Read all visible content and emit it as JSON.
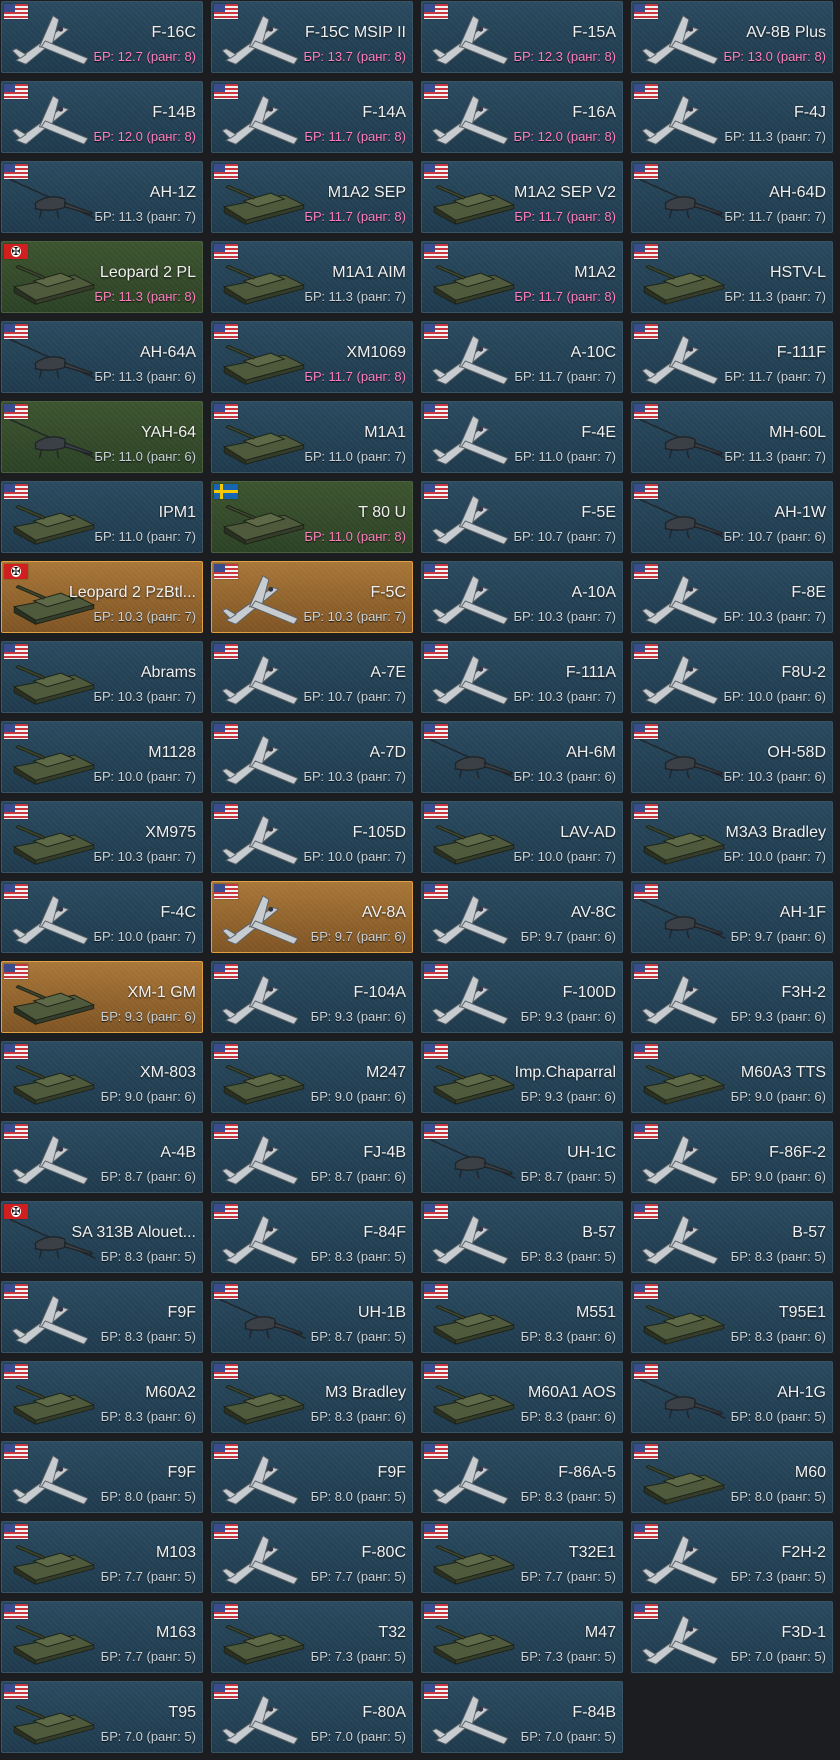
{
  "colors": {
    "background": "#1b1d20",
    "card_blue": "#234357",
    "card_green": "#34492a",
    "card_gold": "#93652e",
    "br_highlight": "#ff7fbf",
    "br_normal": "#c9d2d8"
  },
  "vehicles": [
    {
      "name": "F-16C",
      "br": "БР: 12.7 (ранг: 8)",
      "flag": "usa",
      "kind": "jet",
      "style": "blue",
      "hl": true
    },
    {
      "name": "F-15C MSIP II",
      "br": "БР: 13.7 (ранг: 8)",
      "flag": "usa",
      "kind": "jet",
      "style": "blue",
      "hl": true
    },
    {
      "name": "F-15A",
      "br": "БР: 12.3 (ранг: 8)",
      "flag": "usa",
      "kind": "jet",
      "style": "blue",
      "hl": true
    },
    {
      "name": "AV-8B Plus",
      "br": "БР: 13.0 (ранг: 8)",
      "flag": "usa",
      "kind": "jet",
      "style": "blue",
      "hl": true
    },
    {
      "name": "F-14B",
      "br": "БР: 12.0 (ранг: 8)",
      "flag": "usa",
      "kind": "jet",
      "style": "blue",
      "hl": true
    },
    {
      "name": "F-14A",
      "br": "БР: 11.7 (ранг: 8)",
      "flag": "usa",
      "kind": "jet",
      "style": "blue",
      "hl": true
    },
    {
      "name": "F-16A",
      "br": "БР: 12.0 (ранг: 8)",
      "flag": "usa",
      "kind": "jet",
      "style": "blue",
      "hl": true
    },
    {
      "name": "F-4J",
      "br": "БР: 11.3 (ранг: 7)",
      "flag": "usa",
      "kind": "jet",
      "style": "blue",
      "hl": false
    },
    {
      "name": "AH-1Z",
      "br": "БР: 11.3 (ранг: 7)",
      "flag": "usa",
      "kind": "heli",
      "style": "blue",
      "hl": false
    },
    {
      "name": "M1A2 SEP",
      "br": "БР: 11.7 (ранг: 8)",
      "flag": "usa",
      "kind": "tank",
      "style": "blue",
      "hl": true
    },
    {
      "name": "M1A2 SEP V2",
      "br": "БР: 11.7 (ранг: 8)",
      "flag": "usa",
      "kind": "tank",
      "style": "blue",
      "hl": true
    },
    {
      "name": "AH-64D",
      "br": "БР: 11.7 (ранг: 7)",
      "flag": "usa",
      "kind": "heli",
      "style": "blue",
      "hl": false
    },
    {
      "name": "Leopard 2 PL",
      "br": "БР: 11.3 (ранг: 8)",
      "flag": "germany",
      "kind": "tank",
      "style": "green",
      "hl": true
    },
    {
      "name": "M1A1 AIM",
      "br": "БР: 11.3 (ранг: 7)",
      "flag": "usa",
      "kind": "tank",
      "style": "blue",
      "hl": false
    },
    {
      "name": "M1A2",
      "br": "БР: 11.7 (ранг: 8)",
      "flag": "usa",
      "kind": "tank",
      "style": "blue",
      "hl": true
    },
    {
      "name": "HSTV-L",
      "br": "БР: 11.3 (ранг: 7)",
      "flag": "usa",
      "kind": "tank",
      "style": "blue",
      "hl": false
    },
    {
      "name": "AH-64A",
      "br": "БР: 11.3 (ранг: 6)",
      "flag": "usa",
      "kind": "heli",
      "style": "blue",
      "hl": false
    },
    {
      "name": "XM1069",
      "br": "БР: 11.7 (ранг: 8)",
      "flag": "usa",
      "kind": "tank",
      "style": "blue",
      "hl": true
    },
    {
      "name": "A-10C",
      "br": "БР: 11.7 (ранг: 7)",
      "flag": "usa",
      "kind": "jet",
      "style": "blue",
      "hl": false
    },
    {
      "name": "F-111F",
      "br": "БР: 11.7 (ранг: 7)",
      "flag": "usa",
      "kind": "jet",
      "style": "blue",
      "hl": false
    },
    {
      "name": "YAH-64",
      "br": "БР: 11.0 (ранг: 6)",
      "flag": "usa",
      "kind": "heli",
      "style": "green",
      "hl": false
    },
    {
      "name": "M1A1",
      "br": "БР: 11.0 (ранг: 7)",
      "flag": "usa",
      "kind": "tank",
      "style": "blue",
      "hl": false
    },
    {
      "name": "F-4E",
      "br": "БР: 11.0 (ранг: 7)",
      "flag": "usa",
      "kind": "jet",
      "style": "blue",
      "hl": false
    },
    {
      "name": "MH-60L",
      "br": "БР: 11.3 (ранг: 7)",
      "flag": "usa",
      "kind": "heli",
      "style": "blue",
      "hl": false
    },
    {
      "name": "IPM1",
      "br": "БР: 11.0 (ранг: 7)",
      "flag": "usa",
      "kind": "tank",
      "style": "blue",
      "hl": false
    },
    {
      "name": "T 80 U",
      "br": "БР: 11.0 (ранг: 8)",
      "flag": "sweden",
      "kind": "tank",
      "style": "green",
      "hl": true
    },
    {
      "name": "F-5E",
      "br": "БР: 10.7 (ранг: 7)",
      "flag": "usa",
      "kind": "jet",
      "style": "blue",
      "hl": false
    },
    {
      "name": "AH-1W",
      "br": "БР: 10.7 (ранг: 6)",
      "flag": "usa",
      "kind": "heli",
      "style": "blue",
      "hl": false
    },
    {
      "name": "Leopard 2 PzBtl...",
      "br": "БР: 10.3 (ранг: 7)",
      "flag": "germany",
      "kind": "tank",
      "style": "gold",
      "hl": false
    },
    {
      "name": "F-5C",
      "br": "БР: 10.3 (ранг: 7)",
      "flag": "usa",
      "kind": "jet",
      "style": "gold",
      "hl": false
    },
    {
      "name": "A-10A",
      "br": "БР: 10.3 (ранг: 7)",
      "flag": "usa",
      "kind": "jet",
      "style": "blue",
      "hl": false
    },
    {
      "name": "F-8E",
      "br": "БР: 10.3 (ранг: 7)",
      "flag": "usa",
      "kind": "jet",
      "style": "blue",
      "hl": false
    },
    {
      "name": "Abrams",
      "br": "БР: 10.3 (ранг: 7)",
      "flag": "usa",
      "kind": "tank",
      "style": "blue",
      "hl": false
    },
    {
      "name": "A-7E",
      "br": "БР: 10.7 (ранг: 7)",
      "flag": "usa",
      "kind": "jet",
      "style": "blue",
      "hl": false
    },
    {
      "name": "F-111A",
      "br": "БР: 10.3 (ранг: 7)",
      "flag": "usa",
      "kind": "jet",
      "style": "blue",
      "hl": false
    },
    {
      "name": "F8U-2",
      "br": "БР: 10.0 (ранг: 6)",
      "flag": "usa",
      "kind": "jet",
      "style": "blue",
      "hl": false
    },
    {
      "name": "M1128",
      "br": "БР: 10.0 (ранг: 7)",
      "flag": "usa",
      "kind": "tank",
      "style": "blue",
      "hl": false
    },
    {
      "name": "A-7D",
      "br": "БР: 10.3 (ранг: 7)",
      "flag": "usa",
      "kind": "jet",
      "style": "blue",
      "hl": false
    },
    {
      "name": "AH-6M",
      "br": "БР: 10.3 (ранг: 6)",
      "flag": "usa",
      "kind": "heli",
      "style": "blue",
      "hl": false
    },
    {
      "name": "OH-58D",
      "br": "БР: 10.3 (ранг: 6)",
      "flag": "usa",
      "kind": "heli",
      "style": "blue",
      "hl": false
    },
    {
      "name": "XM975",
      "br": "БР: 10.3 (ранг: 7)",
      "flag": "usa",
      "kind": "tank",
      "style": "blue",
      "hl": false
    },
    {
      "name": "F-105D",
      "br": "БР: 10.0 (ранг: 7)",
      "flag": "usa",
      "kind": "jet",
      "style": "blue",
      "hl": false
    },
    {
      "name": "LAV-AD",
      "br": "БР: 10.0 (ранг: 7)",
      "flag": "usa",
      "kind": "tank",
      "style": "blue",
      "hl": false
    },
    {
      "name": "M3A3 Bradley",
      "br": "БР: 10.0 (ранг: 7)",
      "flag": "usa",
      "kind": "tank",
      "style": "blue",
      "hl": false
    },
    {
      "name": "F-4C",
      "br": "БР: 10.0 (ранг: 7)",
      "flag": "usa",
      "kind": "jet",
      "style": "blue",
      "hl": false
    },
    {
      "name": "AV-8A",
      "br": "БР: 9.7 (ранг: 6)",
      "flag": "usa",
      "kind": "jet",
      "style": "gold",
      "hl": false
    },
    {
      "name": "AV-8C",
      "br": "БР: 9.7 (ранг: 6)",
      "flag": "usa",
      "kind": "jet",
      "style": "blue",
      "hl": false
    },
    {
      "name": "AH-1F",
      "br": "БР: 9.7 (ранг: 6)",
      "flag": "usa",
      "kind": "heli",
      "style": "blue",
      "hl": false
    },
    {
      "name": "XM-1 GM",
      "br": "БР: 9.3 (ранг: 6)",
      "flag": "usa",
      "kind": "tank",
      "style": "gold",
      "hl": false
    },
    {
      "name": "F-104A",
      "br": "БР: 9.3 (ранг: 6)",
      "flag": "usa",
      "kind": "jet",
      "style": "blue",
      "hl": false
    },
    {
      "name": "F-100D",
      "br": "БР: 9.3 (ранг: 6)",
      "flag": "usa",
      "kind": "jet",
      "style": "blue",
      "hl": false
    },
    {
      "name": "F3H-2",
      "br": "БР: 9.3 (ранг: 6)",
      "flag": "usa",
      "kind": "jet",
      "style": "blue",
      "hl": false
    },
    {
      "name": "XM-803",
      "br": "БР: 9.0 (ранг: 6)",
      "flag": "usa",
      "kind": "tank",
      "style": "blue",
      "hl": false
    },
    {
      "name": "M247",
      "br": "БР: 9.0 (ранг: 6)",
      "flag": "usa",
      "kind": "tank",
      "style": "blue",
      "hl": false
    },
    {
      "name": "Imp.Chaparral",
      "br": "БР: 9.3 (ранг: 6)",
      "flag": "usa",
      "kind": "tank",
      "style": "blue",
      "hl": false
    },
    {
      "name": "M60A3 TTS",
      "br": "БР: 9.0 (ранг: 6)",
      "flag": "usa",
      "kind": "tank",
      "style": "blue",
      "hl": false
    },
    {
      "name": "A-4B",
      "br": "БР: 8.7 (ранг: 6)",
      "flag": "usa",
      "kind": "jet",
      "style": "blue",
      "hl": false
    },
    {
      "name": "FJ-4B",
      "br": "БР: 8.7 (ранг: 6)",
      "flag": "usa",
      "kind": "jet",
      "style": "blue",
      "hl": false
    },
    {
      "name": "UH-1C",
      "br": "БР: 8.7 (ранг: 5)",
      "flag": "usa",
      "kind": "heli",
      "style": "blue",
      "hl": false
    },
    {
      "name": "F-86F-2",
      "br": "БР: 9.0 (ранг: 6)",
      "flag": "usa",
      "kind": "jet",
      "style": "blue",
      "hl": false
    },
    {
      "name": "SA 313B Alouet...",
      "br": "БР: 8.3 (ранг: 5)",
      "flag": "germany",
      "kind": "heli",
      "style": "blue",
      "hl": false
    },
    {
      "name": "F-84F",
      "br": "БР: 8.3 (ранг: 5)",
      "flag": "usa",
      "kind": "jet",
      "style": "blue",
      "hl": false
    },
    {
      "name": "B-57",
      "br": "БР: 8.3 (ранг: 5)",
      "flag": "usa",
      "kind": "jet",
      "style": "blue",
      "hl": false
    },
    {
      "name": "B-57",
      "br": "БР: 8.3 (ранг: 5)",
      "flag": "usa",
      "kind": "jet",
      "style": "blue",
      "hl": false
    },
    {
      "name": "F9F",
      "br": "БР: 8.3 (ранг: 5)",
      "flag": "usa",
      "kind": "jet",
      "style": "blue",
      "hl": false
    },
    {
      "name": "UH-1B",
      "br": "БР: 8.7 (ранг: 5)",
      "flag": "usa",
      "kind": "heli",
      "style": "blue",
      "hl": false
    },
    {
      "name": "M551",
      "br": "БР: 8.3 (ранг: 6)",
      "flag": "usa",
      "kind": "tank",
      "style": "blue",
      "hl": false
    },
    {
      "name": "T95E1",
      "br": "БР: 8.3 (ранг: 6)",
      "flag": "usa",
      "kind": "tank",
      "style": "blue",
      "hl": false
    },
    {
      "name": "M60A2",
      "br": "БР: 8.3 (ранг: 6)",
      "flag": "usa",
      "kind": "tank",
      "style": "blue",
      "hl": false
    },
    {
      "name": "M3 Bradley",
      "br": "БР: 8.3 (ранг: 6)",
      "flag": "usa",
      "kind": "tank",
      "style": "blue",
      "hl": false
    },
    {
      "name": "M60A1 AOS",
      "br": "БР: 8.3 (ранг: 6)",
      "flag": "usa",
      "kind": "tank",
      "style": "blue",
      "hl": false
    },
    {
      "name": "AH-1G",
      "br": "БР: 8.0 (ранг: 5)",
      "flag": "usa",
      "kind": "heli",
      "style": "blue",
      "hl": false
    },
    {
      "name": "F9F",
      "br": "БР: 8.0 (ранг: 5)",
      "flag": "usa",
      "kind": "jet",
      "style": "blue",
      "hl": false
    },
    {
      "name": "F9F",
      "br": "БР: 8.0 (ранг: 5)",
      "flag": "usa",
      "kind": "jet",
      "style": "blue",
      "hl": false
    },
    {
      "name": "F-86A-5",
      "br": "БР: 8.3 (ранг: 5)",
      "flag": "usa",
      "kind": "jet",
      "style": "blue",
      "hl": false
    },
    {
      "name": "M60",
      "br": "БР: 8.0 (ранг: 5)",
      "flag": "usa",
      "kind": "tank",
      "style": "blue",
      "hl": false
    },
    {
      "name": "M103",
      "br": "БР: 7.7 (ранг: 5)",
      "flag": "usa",
      "kind": "tank",
      "style": "blue",
      "hl": false
    },
    {
      "name": "F-80C",
      "br": "БР: 7.7 (ранг: 5)",
      "flag": "usa",
      "kind": "jet",
      "style": "blue",
      "hl": false
    },
    {
      "name": "T32E1",
      "br": "БР: 7.7 (ранг: 5)",
      "flag": "usa",
      "kind": "tank",
      "style": "blue",
      "hl": false
    },
    {
      "name": "F2H-2",
      "br": "БР: 7.3 (ранг: 5)",
      "flag": "usa",
      "kind": "jet",
      "style": "blue",
      "hl": false
    },
    {
      "name": "M163",
      "br": "БР: 7.7 (ранг: 5)",
      "flag": "usa",
      "kind": "tank",
      "style": "blue",
      "hl": false
    },
    {
      "name": "T32",
      "br": "БР: 7.3 (ранг: 5)",
      "flag": "usa",
      "kind": "tank",
      "style": "blue",
      "hl": false
    },
    {
      "name": "M47",
      "br": "БР: 7.3 (ранг: 5)",
      "flag": "usa",
      "kind": "tank",
      "style": "blue",
      "hl": false
    },
    {
      "name": "F3D-1",
      "br": "БР: 7.0 (ранг: 5)",
      "flag": "usa",
      "kind": "jet",
      "style": "blue",
      "hl": false
    },
    {
      "name": "T95",
      "br": "БР: 7.0 (ранг: 5)",
      "flag": "usa",
      "kind": "tank",
      "style": "blue",
      "hl": false
    },
    {
      "name": "F-80A",
      "br": "БР: 7.0 (ранг: 5)",
      "flag": "usa",
      "kind": "jet",
      "style": "blue",
      "hl": false
    },
    {
      "name": "F-84B",
      "br": "БР: 7.0 (ранг: 5)",
      "flag": "usa",
      "kind": "jet",
      "style": "blue",
      "hl": false
    }
  ]
}
